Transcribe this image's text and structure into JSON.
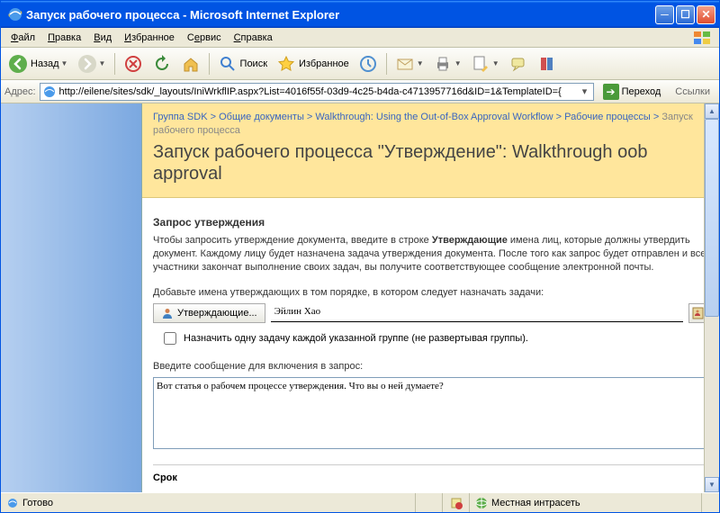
{
  "window": {
    "title": "Запуск рабочего процесса - Microsoft Internet Explorer"
  },
  "menu": {
    "file": "Файл",
    "edit": "Правка",
    "view": "Вид",
    "fav": "Избранное",
    "tools": "Сервис",
    "help": "Справка"
  },
  "toolbar": {
    "back": "Назад",
    "search": "Поиск",
    "favorites": "Избранное"
  },
  "addr": {
    "label": "Адрес:",
    "url": "http://eilene/sites/sdk/_layouts/IniWrkflIP.aspx?List=4016f55f-03d9-4c25-b4da-c4713957716d&ID=1&TemplateID={",
    "go": "Переход",
    "links": "Ссылки"
  },
  "breadcrumb": {
    "a": "Группа SDK",
    "b": "Общие документы",
    "c": "Walkthrough: Using the Out-of-Box Approval Workflow",
    "d": "Рабочие процессы",
    "cur": "Запуск рабочего процесса",
    "sep": " > "
  },
  "page": {
    "title": "Запуск рабочего процесса \"Утверждение\": Walkthrough oob approval"
  },
  "req": {
    "heading": "Запрос утверждения",
    "desc1": "Чтобы запросить утверждение документа, введите в строке ",
    "desc_bold": "Утверждающие",
    "desc2": " имена лиц, которые должны утвердить документ. Каждому лицу будет назначена задача утверждения документа. После того как запрос будет отправлен и все участники закончат выполнение своих задач, вы получите соответствующее сообщение электронной почты.",
    "addlbl": "Добавьте имена утверждающих в том порядке, в котором следует назначать задачи:",
    "apprbtn": "Утверждающие...",
    "apprname": "Эйлин Хао",
    "chk": "Назначить одну задачу каждой указанной группе (не развертывая группы).",
    "msglbl": "Введите сообщение для включения в запрос:",
    "msgval": "Вот статья о рабочем процессе утверждения. Что вы о ней думаете?",
    "deadline": "Срок"
  },
  "status": {
    "ready": "Готово",
    "zone": "Местная интрасеть"
  }
}
